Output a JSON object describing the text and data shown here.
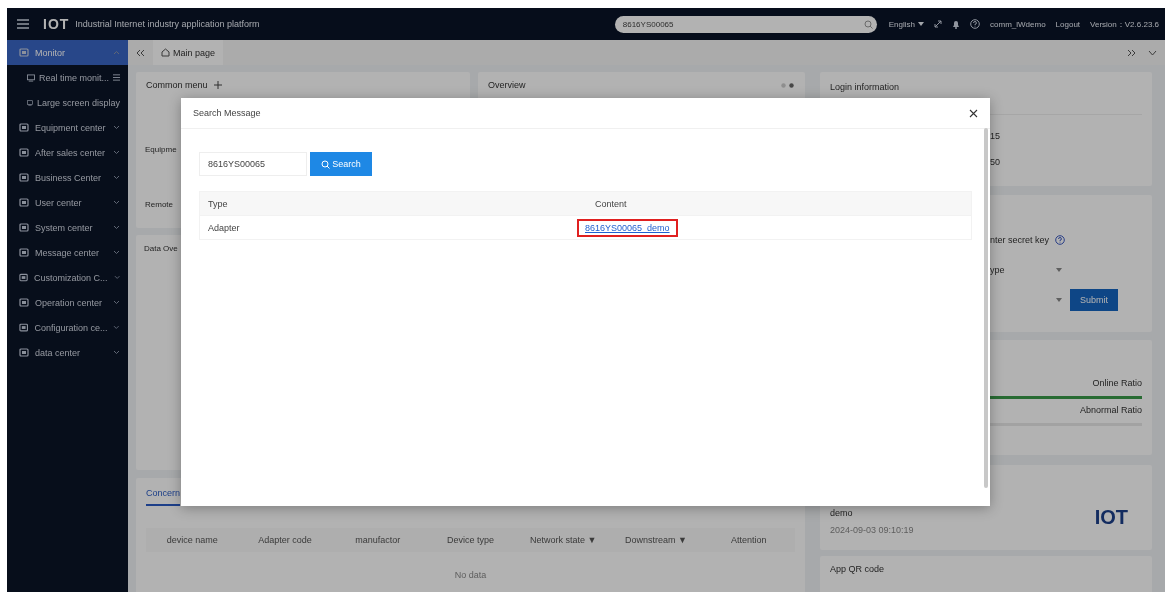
{
  "top_bar": {
    "logo": "IOT",
    "title": "Industrial Internet industry application platform",
    "search": {
      "value": "8616YS00065"
    },
    "language": "English",
    "user": "comm_lWdemo",
    "logout": "Logout",
    "version": "Version：V2.6.23.6"
  },
  "sidebar": {
    "items": [
      {
        "label": "Monitor",
        "selected": true,
        "expanded": true,
        "children": [
          {
            "label": "Real time monit...",
            "selected": false
          },
          {
            "label": "Large screen display",
            "selected": false
          }
        ]
      },
      {
        "label": "Equipment center",
        "selected": false,
        "expanded": false
      },
      {
        "label": "After sales center",
        "selected": false,
        "expanded": false
      },
      {
        "label": "Business Center",
        "selected": false,
        "expanded": false
      },
      {
        "label": "User center",
        "selected": false,
        "expanded": false
      },
      {
        "label": "System center",
        "selected": false,
        "expanded": false
      },
      {
        "label": "Message center",
        "selected": false,
        "expanded": false
      },
      {
        "label": "Customization C...",
        "selected": false,
        "expanded": false
      },
      {
        "label": "Operation center",
        "selected": false,
        "expanded": false
      },
      {
        "label": "Configuration ce...",
        "selected": false,
        "expanded": false
      },
      {
        "label": "data center",
        "selected": false,
        "expanded": false
      }
    ]
  },
  "tabs": [
    {
      "label": "Main page",
      "selected": true
    }
  ],
  "common_menu": {
    "title": "Common menu",
    "items": [
      "Equipme",
      "Remote"
    ]
  },
  "overview": {
    "title": "Overview"
  },
  "data_overview": {
    "title": "Data Ove"
  },
  "concern": {
    "tab": "Concern",
    "columns": [
      "device name",
      "Adapter code",
      "manufactor",
      "Device type",
      "Network state ▼",
      "Downstream ▼",
      "Attention"
    ],
    "empty": "No data"
  },
  "login_info": {
    "title": "Login information",
    "values": [
      "15",
      "50"
    ]
  },
  "key_form": {
    "label": "nter secret key",
    "select": "ype",
    "submit": "Submit"
  },
  "ratios": [
    {
      "label": "Online Ratio",
      "level": 1.0
    },
    {
      "label": "Abnormal Ratio"
    }
  ],
  "account": {
    "name": "demo",
    "time": "2024-09-03 09:10:19",
    "logo": "IOT"
  },
  "qr": {
    "title": "App QR code"
  },
  "dialog": {
    "title": "Search Message",
    "query": "8616YS00065",
    "search_button": "Search",
    "columns": [
      "Type",
      "Content"
    ],
    "rows": [
      {
        "type": "Adapter",
        "content": "8616YS00065_demo",
        "highlighted": true
      }
    ]
  }
}
